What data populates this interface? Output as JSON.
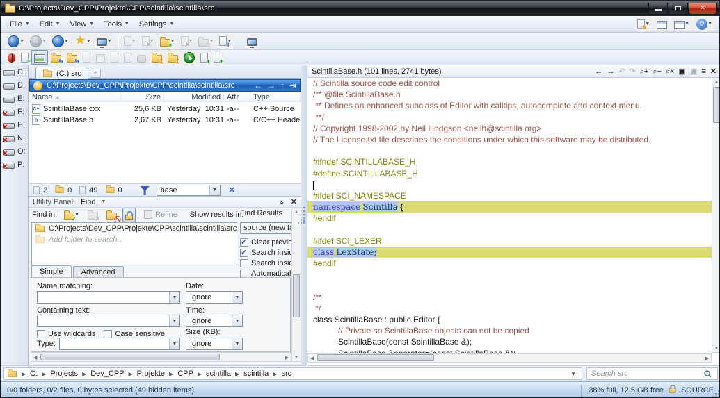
{
  "colors": {
    "accent_path_bar": "#2d74ce",
    "code_comment": "#9b5048",
    "code_preproc": "#82820a",
    "code_keyword": "#5a2bd0",
    "hit_background": "#a9cbe9",
    "highlight_line": "#d9da72",
    "close_button": "#c0392b"
  },
  "window": {
    "title": "C:\\Projects\\Dev_CPP\\Projekte\\CPP\\scintilla\\scintilla\\src"
  },
  "menu": {
    "items": [
      "File",
      "Edit",
      "View",
      "Tools",
      "Settings"
    ],
    "right_icons": [
      {
        "name": "customize-icon",
        "style": "page",
        "badge": "pencil",
        "badge_ch": "✎",
        "dd": true
      },
      {
        "name": "dual-pane-layout-icon",
        "style": "layout split"
      },
      {
        "name": "single-pane-layout-icon",
        "style": "layout",
        "dd": true
      },
      {
        "name": "help-icon",
        "style": "help",
        "ch": "?",
        "dd": true
      }
    ]
  },
  "toolbars": {
    "row1": [
      {
        "name": "back-icon",
        "style": "circle",
        "ch": "←",
        "dd": true
      },
      {
        "name": "forward-icon",
        "style": "circle",
        "ch": "→",
        "dd": true,
        "disabled": true
      },
      {
        "name": "up-icon",
        "style": "circle",
        "ch": "↑",
        "dd": true
      },
      {
        "name": "favorites-icon",
        "style": "star",
        "ch": "★",
        "dd": true
      },
      {
        "name": "network-icon",
        "style": "mon",
        "dd": true
      },
      {
        "sep": true
      },
      {
        "name": "copy-icon",
        "style": "page",
        "disabled": true,
        "dd": true
      },
      {
        "name": "move-icon",
        "style": "page",
        "badge": "x",
        "badge_ch": "✕",
        "disabled": true,
        "dd": true
      },
      {
        "name": "new-folder-icon",
        "style": "folder",
        "badge": "plus",
        "badge_ch": "+",
        "dd": true
      },
      {
        "name": "delete-icon",
        "style": "page",
        "badge": "x",
        "badge_ch": "✕",
        "disabled": true,
        "dd": true
      },
      {
        "name": "rename-icon",
        "style": "folder",
        "badge": "up",
        "badge_ch": "↰",
        "disabled": true,
        "dd": true
      },
      {
        "name": "properties-icon",
        "style": "page",
        "badge": "q",
        "badge_ch": "i",
        "dd": true
      },
      {
        "gap": true
      },
      {
        "name": "console-window-icon",
        "style": "mon"
      }
    ],
    "row2": [
      {
        "name": "debug-bug-icon",
        "style": "bug"
      },
      {
        "name": "new-tab-pane-icon",
        "style": "page",
        "badge": "plus",
        "badge_ch": "+"
      },
      {
        "name": "quick-viewer-icon",
        "style": "img",
        "pressed": true
      },
      {
        "name": "sync-browse-left-icon",
        "style": "folder",
        "badge": "sync",
        "badge_ch": "⇆"
      },
      {
        "name": "sync-browse-right-icon",
        "style": "folder",
        "badge": "sync",
        "badge_ch": "⇆"
      },
      {
        "name": "clipboard-icon",
        "style": "page",
        "disabled": true
      },
      {
        "name": "scheduler-icon",
        "style": "cal",
        "disabled": true
      },
      {
        "name": "save-selection-icon",
        "style": "page",
        "disabled": true
      },
      {
        "name": "copy-pane-icon",
        "style": "page",
        "disabled": true
      },
      {
        "name": "drag-hand-icon",
        "style": "hand",
        "disabled": true
      },
      {
        "name": "folder-up-icon",
        "style": "folder",
        "badge": "up",
        "badge_ch": "↥"
      },
      {
        "name": "folder-up-new-tab-icon",
        "style": "folder",
        "badge": "up",
        "badge_ch": "↥"
      },
      {
        "name": "execute-icon",
        "style": "run"
      },
      {
        "name": "add-left-pane-icon",
        "style": "page",
        "badge": "plus",
        "badge_ch": "+"
      },
      {
        "name": "add-right-pane-icon",
        "style": "page",
        "badge": "plus",
        "badge_ch": "+"
      }
    ],
    "path_nav": [
      {
        "name": "path-back-icon",
        "ch": "←"
      },
      {
        "name": "path-forward-icon",
        "ch": "→"
      },
      {
        "name": "path-up-icon",
        "ch": "↑"
      },
      {
        "name": "path-follow-icon",
        "ch": "⇥"
      }
    ],
    "viewer": [
      {
        "name": "viewer-back-icon",
        "ch": "←",
        "bold": true
      },
      {
        "name": "viewer-forward-icon",
        "ch": "→",
        "bold": true
      },
      {
        "name": "viewer-undo-icon",
        "ch": "↶",
        "dis": true
      },
      {
        "name": "viewer-redo-icon",
        "ch": "↷",
        "dis": true
      },
      {
        "name": "zoom-in-icon",
        "ch": "⌕",
        "sup": "+"
      },
      {
        "name": "zoom-out-icon",
        "ch": "⌕",
        "sup": "−"
      },
      {
        "name": "zoom-reset-icon",
        "ch": "⌕",
        "sup": "×"
      },
      {
        "name": "viewer-frame-icon",
        "ch": "▣"
      },
      {
        "name": "viewer-frame2-icon",
        "ch": "▣",
        "dis": true
      },
      {
        "name": "viewer-menu-icon",
        "ch": "≡",
        "bold": true
      },
      {
        "name": "viewer-close-icon",
        "ch": "✕",
        "bold": true
      }
    ]
  },
  "drives": [
    {
      "letter": "C:",
      "state": "ok"
    },
    {
      "letter": "D:",
      "state": "ok"
    },
    {
      "letter": "E:",
      "state": "empty"
    },
    {
      "letter": "F:",
      "state": "error"
    },
    {
      "letter": "H:",
      "state": "error"
    },
    {
      "letter": "N:",
      "state": "error"
    },
    {
      "letter": "O:",
      "state": "error"
    },
    {
      "letter": "P:",
      "state": "error"
    }
  ],
  "tab": {
    "label": "(C:) src",
    "new_tab": "+"
  },
  "pathbar": {
    "path": "C:\\Projects\\Dev_CPP\\Projekte\\CPP\\scintilla\\scintilla\\src"
  },
  "filelist": {
    "columns": [
      "Name",
      "Size",
      "Modified",
      "Attr",
      "Type"
    ],
    "rows": [
      {
        "icon": "C+",
        "name": "ScintillaBase.cxx",
        "size": "25,6 KB",
        "modified": "Yesterday  10:31",
        "attr": "-a--",
        "type": "C++ Source"
      },
      {
        "icon": "h",
        "name": "ScintillaBase.h",
        "size": "2,67 KB",
        "modified": "Yesterday  10:31",
        "attr": "-a--",
        "type": "C/C++ Header"
      }
    ]
  },
  "counts": {
    "files_shown": "2",
    "folders_shown": "0",
    "files_hidden": "49",
    "folders_hidden": "0",
    "filter_value": "base"
  },
  "utility_panel": {
    "title": "Utility Panel:",
    "mode": "Find"
  },
  "find": {
    "find_in_label": "Find in:",
    "refine_label": "Refine",
    "show_results_label": "Show results in:",
    "results_header": "Find Results",
    "results_target": "source (new tab",
    "folders": [
      "C:\\Projects\\Dev_CPP\\Projekte\\CPP\\scintilla\\scintilla\\src"
    ],
    "add_folder_placeholder": "Add folder to search...",
    "options": [
      {
        "label": "Clear previou",
        "checked": true
      },
      {
        "label": "Search inside",
        "checked": true
      },
      {
        "label": "Search inside",
        "checked": false
      },
      {
        "label": "Automatically",
        "checked": false
      }
    ],
    "tabs": [
      "Simple",
      "Advanced"
    ],
    "active_tab": "Simple",
    "form": {
      "name_matching": "Name matching:",
      "containing_text": "Containing text:",
      "type_label": "Type:",
      "date_label": "Date:",
      "time_label": "Time:",
      "size_label": "Size (KB):",
      "ignore": "Ignore",
      "use_wildcards": "Use wildcards",
      "case_sensitive": "Case sensitive"
    }
  },
  "viewer": {
    "title": "ScintillaBase.h (101 lines, 2741 bytes)",
    "lines": [
      {
        "seg": [
          [
            "c",
            "// Scintilla source code edit control"
          ]
        ]
      },
      {
        "seg": [
          [
            "c",
            "/** @file ScintillaBase.h"
          ]
        ]
      },
      {
        "seg": [
          [
            "c",
            " ** Defines an enhanced subclass of Editor with calltips, autocomplete and context menu."
          ]
        ]
      },
      {
        "seg": [
          [
            "c",
            " **/"
          ]
        ]
      },
      {
        "seg": [
          [
            "c",
            "// Copyright 1998-2002 by Neil Hodgson <neilh@scintilla.org>"
          ]
        ]
      },
      {
        "seg": [
          [
            "c",
            "// The License.txt file describes the conditions under which this software may be distributed."
          ]
        ]
      },
      {
        "seg": []
      },
      {
        "seg": [
          [
            "p",
            "#ifndef SCINTILLABASE_H"
          ]
        ]
      },
      {
        "seg": [
          [
            "p",
            "#define SCINTILLABASE_H"
          ]
        ]
      },
      {
        "seg": [],
        "cursor": true
      },
      {
        "seg": [
          [
            "p",
            "#ifdef SCI_NAMESPACE"
          ]
        ]
      },
      {
        "hl": true,
        "seg": [
          [
            "k",
            "namespace"
          ],
          [
            "n",
            " "
          ],
          [
            "h",
            "Scintilla"
          ],
          [
            "n",
            " "
          ],
          [
            "b",
            "{"
          ]
        ]
      },
      {
        "seg": [
          [
            "p",
            "#endif"
          ]
        ]
      },
      {
        "seg": []
      },
      {
        "seg": [
          [
            "p",
            "#ifdef SCI_LEXER"
          ]
        ]
      },
      {
        "hl": true,
        "seg": [
          [
            "k",
            "class"
          ],
          [
            "n",
            " "
          ],
          [
            "h",
            "LexState;"
          ]
        ]
      },
      {
        "seg": [
          [
            "p",
            "#endif"
          ]
        ]
      },
      {
        "seg": []
      },
      {
        "seg": []
      },
      {
        "seg": [
          [
            "c",
            "/**"
          ]
        ]
      },
      {
        "seg": [
          [
            "c",
            " */"
          ]
        ]
      },
      {
        "seg": [
          [
            "n",
            "class ScintillaBase : public Editor {"
          ]
        ]
      },
      {
        "ind": true,
        "seg": [
          [
            "c",
            "// Private so ScintillaBase objects can not be copied"
          ]
        ]
      },
      {
        "ind": true,
        "seg": [
          [
            "n",
            "ScintillaBase(const ScintillaBase &);"
          ]
        ]
      },
      {
        "ind": true,
        "seg": [
          [
            "n",
            "ScintillaBase &operator=(const ScintillaBase &);"
          ]
        ]
      }
    ]
  },
  "breadcrumb": {
    "items": [
      "C:",
      "Projects",
      "Dev_CPP",
      "Projekte",
      "CPP",
      "scintilla",
      "scintilla",
      "src"
    ]
  },
  "search": {
    "placeholder": "Search src"
  },
  "statusbar": {
    "left": "0/0 folders, 0/2 files, 0 bytes selected (49 hidden items)",
    "disk": "38% full, 12,5 GB free",
    "label": "SOURCE"
  }
}
